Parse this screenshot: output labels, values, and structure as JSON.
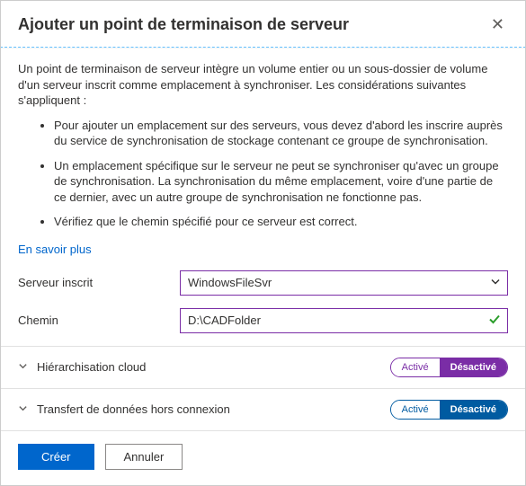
{
  "header": {
    "title": "Ajouter un point de terminaison de serveur"
  },
  "intro": "Un point de terminaison de serveur intègre un volume entier ou un sous-dossier de volume d'un serveur inscrit comme emplacement à synchroniser. Les considérations suivantes s'appliquent :",
  "bullets": [
    "Pour ajouter un emplacement sur des serveurs, vous devez d'abord les inscrire auprès du service de synchronisation de stockage contenant ce groupe de synchronisation.",
    "Un emplacement spécifique sur le serveur ne peut se synchroniser qu'avec un groupe de synchronisation. La synchronisation du même emplacement, voire d'une partie de ce dernier, avec un autre groupe de synchronisation ne fonctionne pas.",
    "Vérifiez que le chemin spécifié pour ce serveur est correct."
  ],
  "links": {
    "learn_more": "En savoir plus"
  },
  "form": {
    "server_label": "Serveur inscrit",
    "server_value": "WindowsFileSvr",
    "path_label": "Chemin",
    "path_value": "D:\\CADFolder"
  },
  "sections": {
    "cloud_tiering": {
      "title": "Hiérarchisation cloud",
      "toggle": {
        "on": "Activé",
        "off": "Désactivé",
        "state": "off"
      }
    },
    "offline_transfer": {
      "title": "Transfert de données hors connexion",
      "toggle": {
        "on": "Activé",
        "off": "Désactivé",
        "state": "off"
      }
    }
  },
  "footer": {
    "create": "Créer",
    "cancel": "Annuler"
  }
}
